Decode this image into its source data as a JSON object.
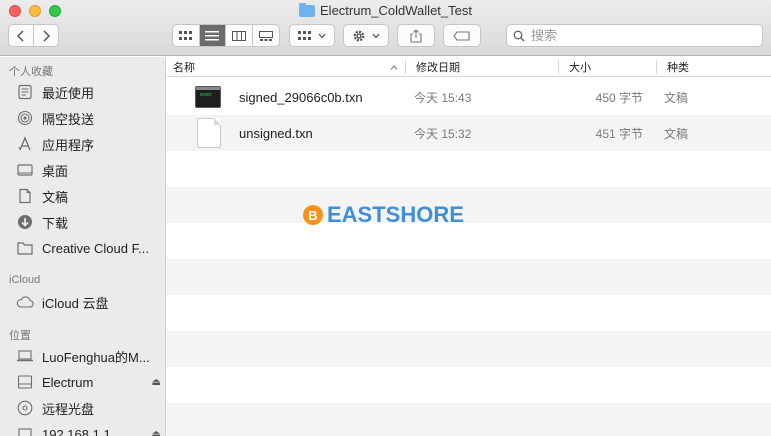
{
  "window": {
    "title": "Electrum_ColdWallet_Test"
  },
  "toolbar": {
    "back_icon": "chevron-left-icon",
    "forward_icon": "chevron-right-icon",
    "views": [
      "icon-view",
      "list-view",
      "column-view",
      "gallery-view"
    ],
    "active_view": "list-view",
    "share_icon": "share-icon",
    "tag_icon": "tag-icon"
  },
  "search": {
    "placeholder": "搜索"
  },
  "sidebar": {
    "favorites_header": "个人收藏",
    "favorites": [
      {
        "label": "最近使用",
        "icon": "recents-icon"
      },
      {
        "label": "隔空投送",
        "icon": "airdrop-icon"
      },
      {
        "label": "应用程序",
        "icon": "applications-icon"
      },
      {
        "label": "桌面",
        "icon": "desktop-icon"
      },
      {
        "label": "文稿",
        "icon": "documents-icon"
      },
      {
        "label": "下载",
        "icon": "downloads-icon"
      },
      {
        "label": "Creative Cloud F...",
        "icon": "folder-icon"
      }
    ],
    "icloud_header": "iCloud",
    "icloud": [
      {
        "label": "iCloud 云盘",
        "icon": "cloud-icon"
      }
    ],
    "locations_header": "位置",
    "locations": [
      {
        "label": "LuoFenghua的M...",
        "icon": "laptop-icon"
      },
      {
        "label": "Electrum",
        "icon": "drive-icon"
      },
      {
        "label": "远程光盘",
        "icon": "disc-icon"
      },
      {
        "label": "192.168.1.1",
        "icon": "network-icon"
      }
    ]
  },
  "columns": {
    "name": "名称",
    "modified": "修改日期",
    "size": "大小",
    "kind": "种类"
  },
  "files": [
    {
      "name": "signed_29066c0b.txn",
      "modified": "今天 15:43",
      "size": "450 字节",
      "kind": "文稿",
      "icon": "executable-icon"
    },
    {
      "name": "unsigned.txn",
      "modified": "今天 15:32",
      "size": "451 字节",
      "kind": "文稿",
      "icon": "document-icon"
    }
  ],
  "exec_icon_text": "exec",
  "watermark": {
    "coin_glyph": "B",
    "text": "EASTSHORE",
    "coin_color": "#f7931a",
    "text_color": "#3f8fd8"
  }
}
